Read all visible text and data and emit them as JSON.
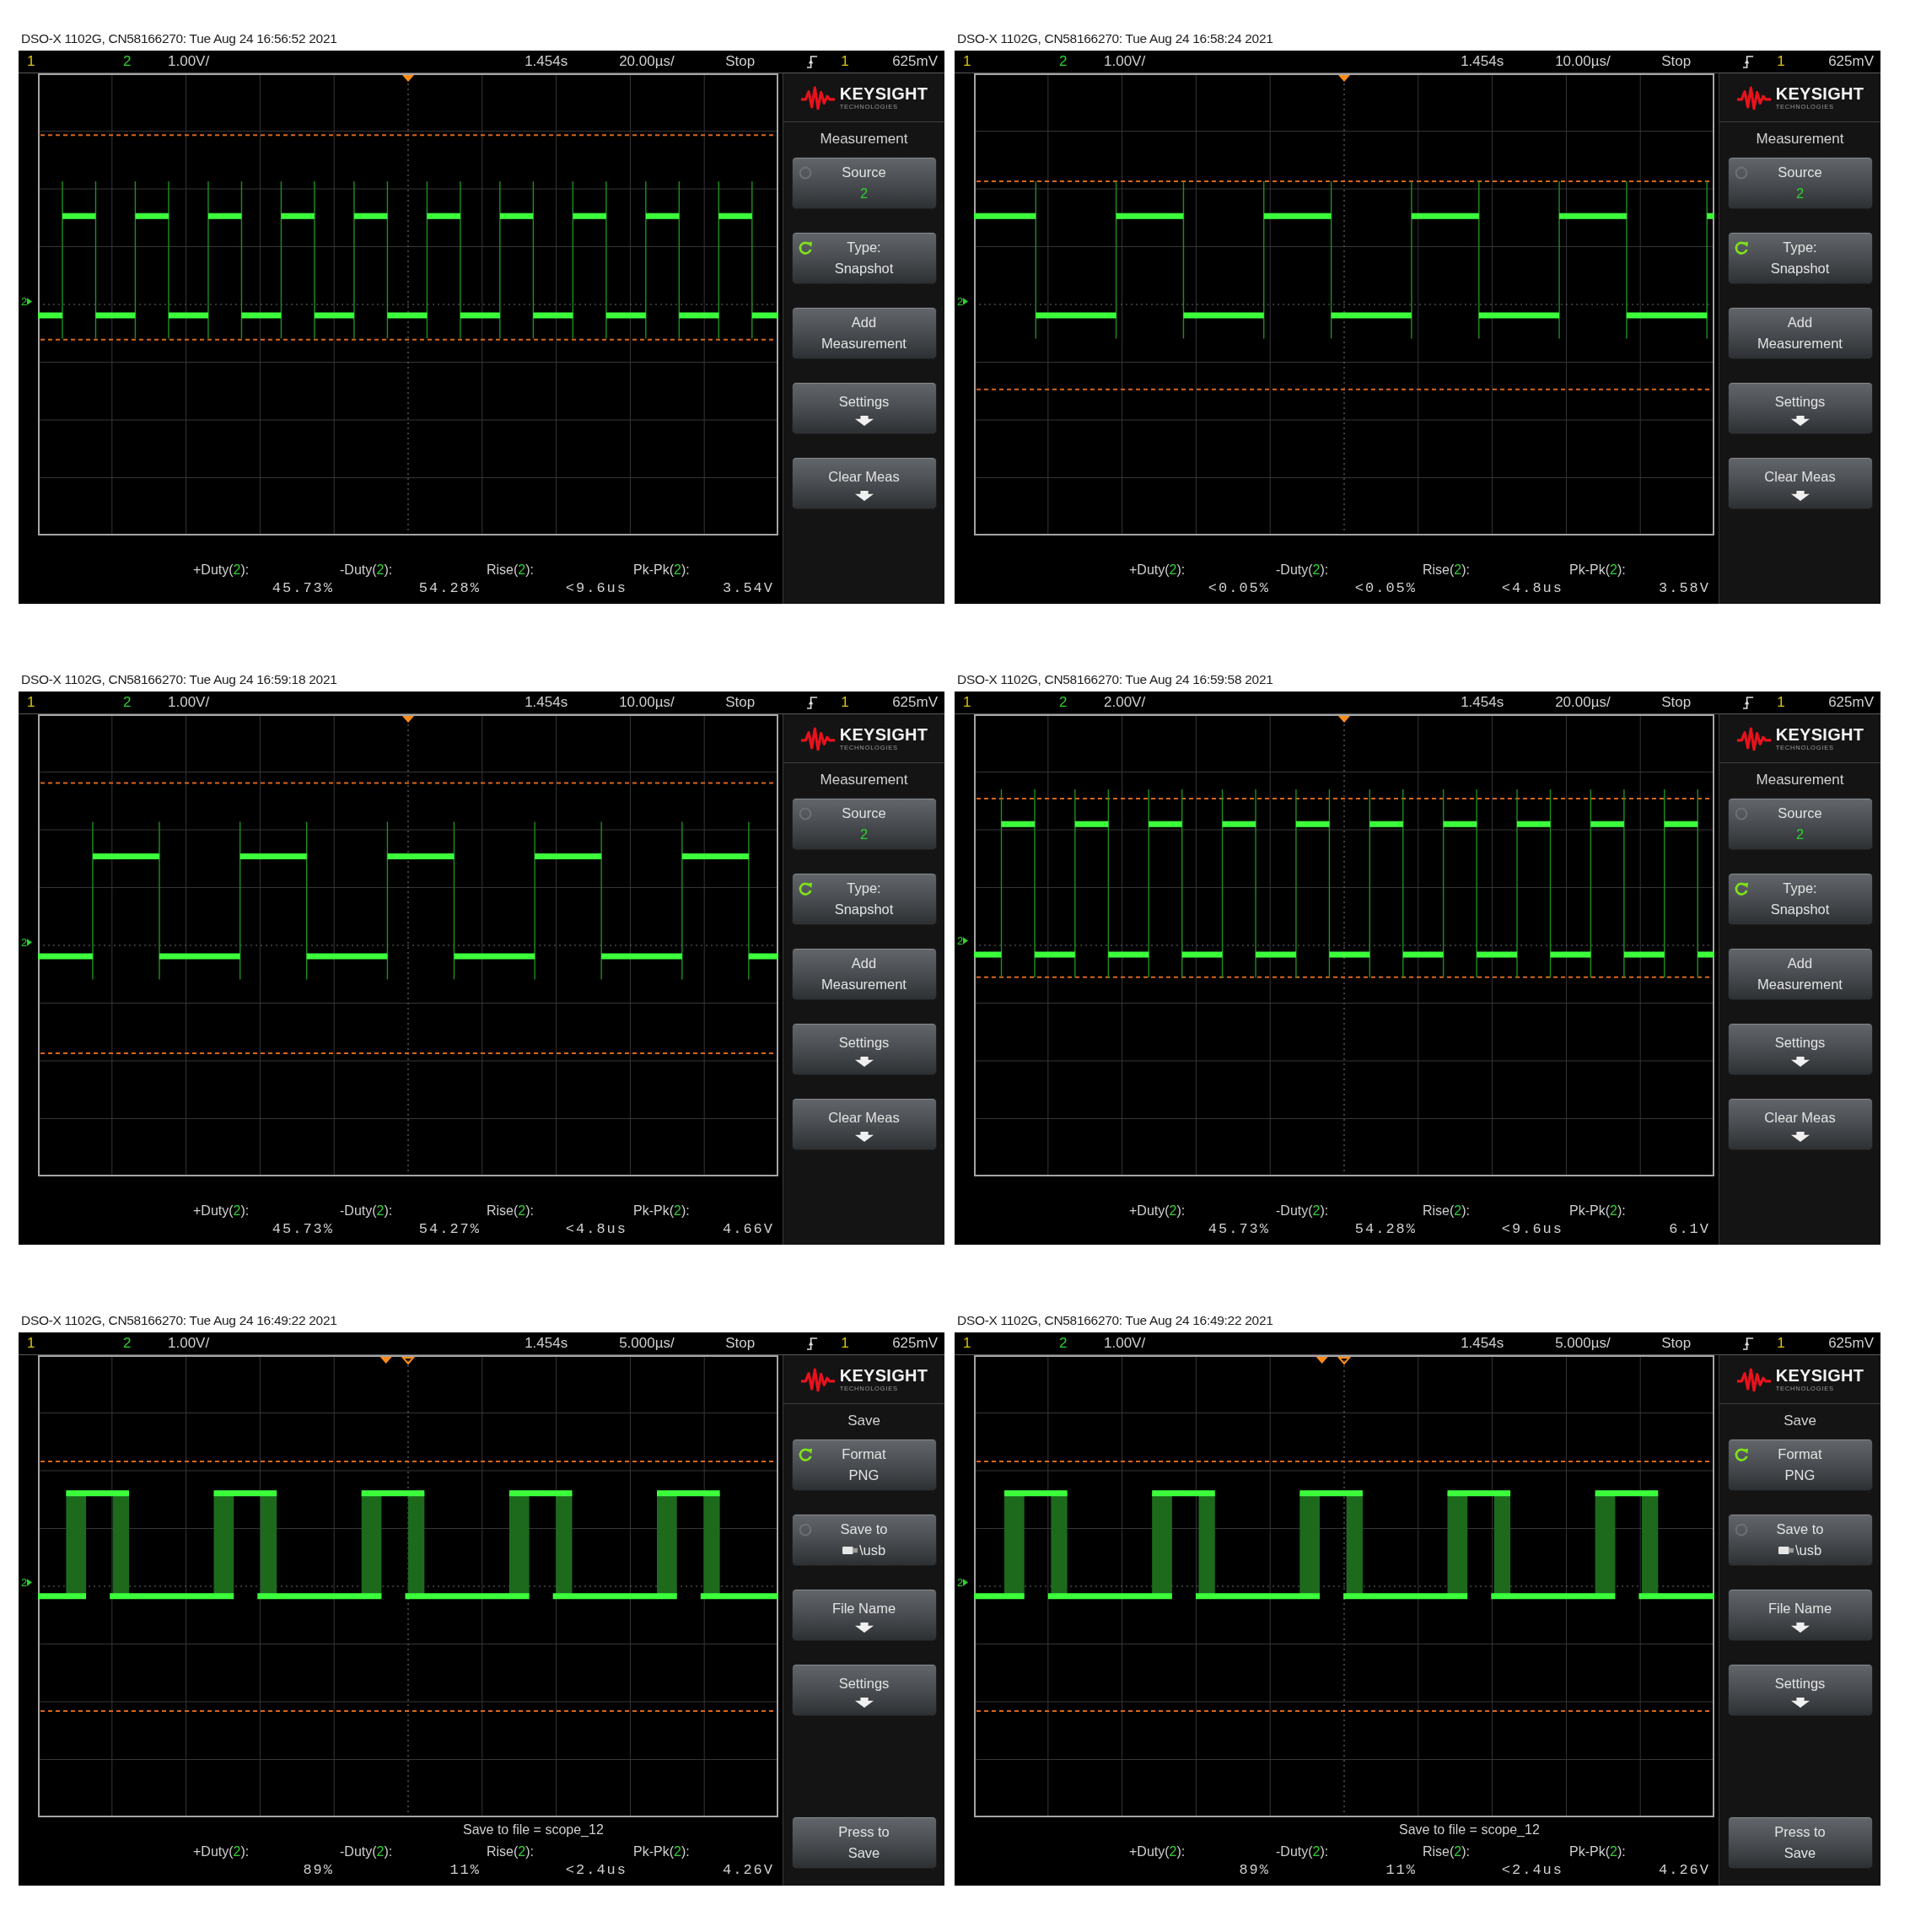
{
  "panels": [
    {
      "caption": "DSO-X 1102G, CN58166270: Tue Aug 24 16:56:52 2021",
      "status": {
        "channels": [
          {
            "number": "1",
            "color": "#d8c40a"
          },
          {
            "number": "2",
            "color": "#2fd12f",
            "scale": "1.00V/"
          }
        ],
        "delay": "1.454s",
        "timebase": "20.00µs/",
        "run_state": "Stop",
        "trigger_source": "1",
        "trigger_level": "625mV"
      },
      "ground_marker": "2",
      "menu": {
        "logo": {
          "name": "KEYSIGHT",
          "tagline": "TECHNOLOGIES"
        },
        "title": "Measurement",
        "softkeys": [
          {
            "kind": "channel",
            "label": "Source",
            "value": "2",
            "knob_active": false
          },
          {
            "kind": "option",
            "label": "Type:",
            "value": "Snapshot",
            "knob_active": true
          },
          {
            "kind": "action",
            "lines": [
              "Add",
              "Measurement"
            ]
          },
          {
            "kind": "submenu",
            "label": "Settings"
          },
          {
            "kind": "submenu",
            "label": "Clear Meas"
          }
        ]
      },
      "measurements": [
        {
          "name": "+Duty(",
          "source": "2",
          "end": "):",
          "value": "45.73%"
        },
        {
          "name": "-Duty(",
          "source": "2",
          "end": "):",
          "value": "54.28%"
        },
        {
          "name": "Rise(",
          "source": "2",
          "end": "):",
          "value": "<9.6us"
        },
        {
          "name": "Pk-Pk(",
          "source": "2",
          "end": "):",
          "value": "3.54V"
        }
      ]
    },
    {
      "caption": "DSO-X 1102G, CN58166270: Tue Aug 24 16:58:24 2021",
      "status": {
        "channels": [
          {
            "number": "1",
            "color": "#d8c40a"
          },
          {
            "number": "2",
            "color": "#2fd12f",
            "scale": "1.00V/"
          }
        ],
        "delay": "1.454s",
        "timebase": "10.00µs/",
        "run_state": "Stop",
        "trigger_source": "1",
        "trigger_level": "625mV"
      },
      "ground_marker": "2",
      "menu": {
        "logo": {
          "name": "KEYSIGHT",
          "tagline": "TECHNOLOGIES"
        },
        "title": "Measurement",
        "softkeys": [
          {
            "kind": "channel",
            "label": "Source",
            "value": "2",
            "knob_active": false
          },
          {
            "kind": "option",
            "label": "Type:",
            "value": "Snapshot",
            "knob_active": true
          },
          {
            "kind": "action",
            "lines": [
              "Add",
              "Measurement"
            ]
          },
          {
            "kind": "submenu",
            "label": "Settings"
          },
          {
            "kind": "submenu",
            "label": "Clear Meas"
          }
        ]
      },
      "measurements": [
        {
          "name": "+Duty(",
          "source": "2",
          "end": "):",
          "value": "<0.05%"
        },
        {
          "name": "-Duty(",
          "source": "2",
          "end": "):",
          "value": "<0.05%"
        },
        {
          "name": "Rise(",
          "source": "2",
          "end": "):",
          "value": "<4.8us"
        },
        {
          "name": "Pk-Pk(",
          "source": "2",
          "end": "):",
          "value": "3.58V"
        }
      ]
    },
    {
      "caption": "DSO-X 1102G, CN58166270: Tue Aug 24 16:59:18 2021",
      "status": {
        "channels": [
          {
            "number": "1",
            "color": "#d8c40a"
          },
          {
            "number": "2",
            "color": "#2fd12f",
            "scale": "1.00V/"
          }
        ],
        "delay": "1.454s",
        "timebase": "10.00µs/",
        "run_state": "Stop",
        "trigger_source": "1",
        "trigger_level": "625mV"
      },
      "ground_marker": "2",
      "menu": {
        "logo": {
          "name": "KEYSIGHT",
          "tagline": "TECHNOLOGIES"
        },
        "title": "Measurement",
        "softkeys": [
          {
            "kind": "channel",
            "label": "Source",
            "value": "2",
            "knob_active": false
          },
          {
            "kind": "option",
            "label": "Type:",
            "value": "Snapshot",
            "knob_active": true
          },
          {
            "kind": "action",
            "lines": [
              "Add",
              "Measurement"
            ]
          },
          {
            "kind": "submenu",
            "label": "Settings"
          },
          {
            "kind": "submenu",
            "label": "Clear Meas"
          }
        ]
      },
      "measurements": [
        {
          "name": "+Duty(",
          "source": "2",
          "end": "):",
          "value": "45.73%"
        },
        {
          "name": "-Duty(",
          "source": "2",
          "end": "):",
          "value": "54.27%"
        },
        {
          "name": "Rise(",
          "source": "2",
          "end": "):",
          "value": "<4.8us"
        },
        {
          "name": "Pk-Pk(",
          "source": "2",
          "end": "):",
          "value": "4.66V"
        }
      ]
    },
    {
      "caption": "DSO-X 1102G, CN58166270: Tue Aug 24 16:59:58 2021",
      "status": {
        "channels": [
          {
            "number": "1",
            "color": "#d8c40a"
          },
          {
            "number": "2",
            "color": "#2fd12f",
            "scale": "2.00V/"
          }
        ],
        "delay": "1.454s",
        "timebase": "20.00µs/",
        "run_state": "Stop",
        "trigger_source": "1",
        "trigger_level": "625mV"
      },
      "ground_marker": "2",
      "menu": {
        "logo": {
          "name": "KEYSIGHT",
          "tagline": "TECHNOLOGIES"
        },
        "title": "Measurement",
        "softkeys": [
          {
            "kind": "channel",
            "label": "Source",
            "value": "2",
            "knob_active": false
          },
          {
            "kind": "option",
            "label": "Type:",
            "value": "Snapshot",
            "knob_active": true
          },
          {
            "kind": "action",
            "lines": [
              "Add",
              "Measurement"
            ]
          },
          {
            "kind": "submenu",
            "label": "Settings"
          },
          {
            "kind": "submenu",
            "label": "Clear Meas"
          }
        ]
      },
      "measurements": [
        {
          "name": "+Duty(",
          "source": "2",
          "end": "):",
          "value": "45.73%"
        },
        {
          "name": "-Duty(",
          "source": "2",
          "end": "):",
          "value": "54.28%"
        },
        {
          "name": "Rise(",
          "source": "2",
          "end": "):",
          "value": "<9.6us"
        },
        {
          "name": "Pk-Pk(",
          "source": "2",
          "end": "):",
          "value": "6.1V"
        }
      ]
    },
    {
      "caption": "DSO-X 1102G, CN58166270: Tue Aug 24 16:49:22 2021",
      "status": {
        "channels": [
          {
            "number": "1",
            "color": "#d8c40a"
          },
          {
            "number": "2",
            "color": "#2fd12f",
            "scale": "1.00V/"
          }
        ],
        "delay": "1.454s",
        "timebase": "5.000µs/",
        "run_state": "Stop",
        "trigger_source": "1",
        "trigger_level": "625mV"
      },
      "ground_marker": "2",
      "menu": {
        "logo": {
          "name": "KEYSIGHT",
          "tagline": "TECHNOLOGIES"
        },
        "title": "Save",
        "softkeys": [
          {
            "kind": "option",
            "label": "Format",
            "value": "PNG",
            "knob_active": true
          },
          {
            "kind": "path",
            "label": "Save to",
            "value": "\\usb",
            "knob_active": false
          },
          {
            "kind": "submenu",
            "label": "File Name"
          },
          {
            "kind": "submenu",
            "label": "Settings"
          }
        ],
        "bottom_softkeys": [
          {
            "kind": "action",
            "lines": [
              "Press to",
              "Save"
            ]
          }
        ]
      },
      "save_status": "Save to file = scope_12",
      "measurements": [
        {
          "name": "+Duty(",
          "source": "2",
          "end": "):",
          "value": "89%"
        },
        {
          "name": "-Duty(",
          "source": "2",
          "end": "):",
          "value": "11%"
        },
        {
          "name": "Rise(",
          "source": "2",
          "end": "):",
          "value": "<2.4us"
        },
        {
          "name": "Pk-Pk(",
          "source": "2",
          "end": "):",
          "value": "4.26V"
        }
      ]
    },
    {
      "caption": "DSO-X 1102G, CN58166270: Tue Aug 24 16:49:22 2021",
      "status": {
        "channels": [
          {
            "number": "1",
            "color": "#d8c40a"
          },
          {
            "number": "2",
            "color": "#2fd12f",
            "scale": "1.00V/"
          }
        ],
        "delay": "1.454s",
        "timebase": "5.000µs/",
        "run_state": "Stop",
        "trigger_source": "1",
        "trigger_level": "625mV"
      },
      "ground_marker": "2",
      "menu": {
        "logo": {
          "name": "KEYSIGHT",
          "tagline": "TECHNOLOGIES"
        },
        "title": "Save",
        "softkeys": [
          {
            "kind": "option",
            "label": "Format",
            "value": "PNG",
            "knob_active": true
          },
          {
            "kind": "path",
            "label": "Save to",
            "value": "\\usb",
            "knob_active": false
          },
          {
            "kind": "submenu",
            "label": "File Name"
          },
          {
            "kind": "submenu",
            "label": "Settings"
          }
        ],
        "bottom_softkeys": [
          {
            "kind": "action",
            "lines": [
              "Press to",
              "Save"
            ]
          }
        ]
      },
      "save_status": "Save to file = scope_12",
      "measurements": [
        {
          "name": "+Duty(",
          "source": "2",
          "end": "):",
          "value": "89%"
        },
        {
          "name": "-Duty(",
          "source": "2",
          "end": "):",
          "value": "11%"
        },
        {
          "name": "Rise(",
          "source": "2",
          "end": "):",
          "value": "<2.4us"
        },
        {
          "name": "Pk-Pk(",
          "source": "2",
          "end": "):",
          "value": "4.26V"
        }
      ]
    }
  ]
}
